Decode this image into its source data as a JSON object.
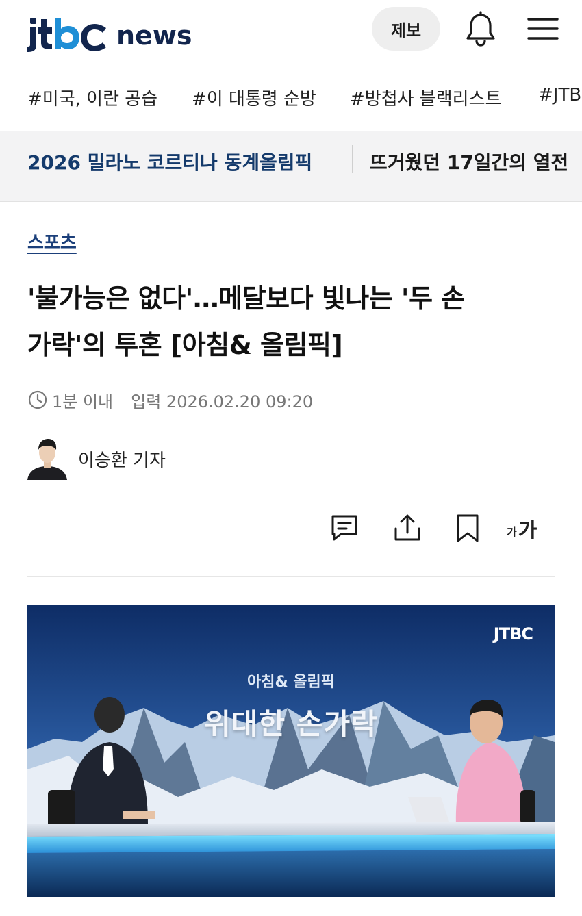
{
  "header": {
    "logo_main": "JTBC",
    "logo_news": "news",
    "report_button": "제보",
    "icons": [
      "bell-icon",
      "menu-icon"
    ]
  },
  "hashtags": [
    "#미국, 이란 공습",
    "#이 대통령 순방",
    "#방첩사 블랙리스트",
    "#JTBC"
  ],
  "banner": {
    "title": "2026 밀라노 코르티나 동계올림픽",
    "subtitle": "뜨거웠던 17일간의 열전"
  },
  "article": {
    "category": "스포츠",
    "headline_line1": "'불가능은 없다'…메달보다 빛나는 '두 손",
    "headline_line2": "가락'의 투혼 [아침& 올림픽]",
    "read_time": "1분 이내",
    "published": "입력 2026.02.20 09:20",
    "reporter": "이승환 기자"
  },
  "toolbar": {
    "icons": [
      "comment-icon",
      "share-icon",
      "bookmark-icon",
      "font-size-icon"
    ],
    "font_small": "가",
    "font_large": "가"
  },
  "media": {
    "logo": "JTBC",
    "program": "아침& 올림픽",
    "caption": "위대한 손가락"
  },
  "colors": {
    "brand_navy": "#12254d",
    "brand_blue": "#1f8fd6",
    "category": "#1b3f7a",
    "banner_bg": "#f3f3f4"
  }
}
